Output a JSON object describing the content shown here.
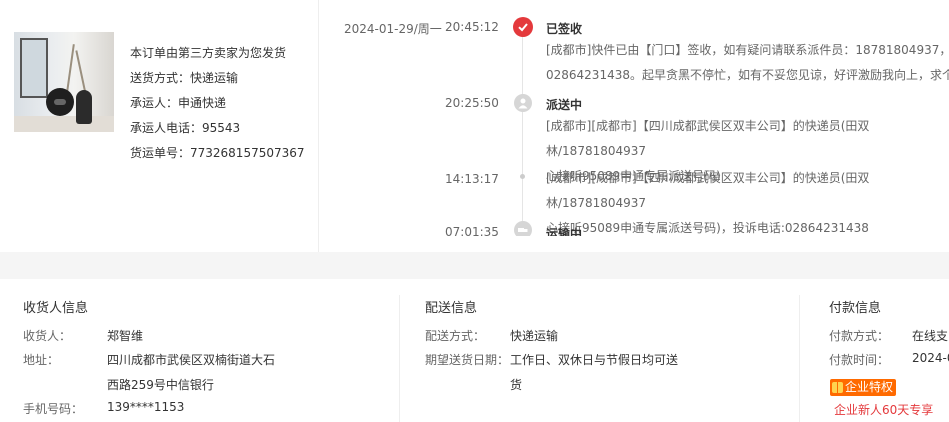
{
  "shipping": {
    "seller_note": "本订单由第三方卖家为您发货",
    "method": "送货方式：快递运输",
    "carrier": "承运人：申通快递",
    "carrier_phone": "承运人电话：95543",
    "tracking_no": "货运单号：773268157507367"
  },
  "timeline": {
    "date": "2024-01-29/周一",
    "events": [
      {
        "time": "20:45:12",
        "status": "已签收",
        "lines": [
          "[成都市]快件已由【门口】签收，如有疑问请联系派件员：18781804937，投",
          "02864231438。起早贪黑不停忙，如有不妥您见谅，好评激励我向上，求个五"
        ]
      },
      {
        "time": "20:25:50",
        "status": "派送中",
        "lines": [
          "[成都市][成都市]【四川成都武侯区双丰公司】的快递员(田双林/18781804937",
          "心接听95089申通专属派送号码)"
        ]
      },
      {
        "time": "14:13:17",
        "status": "",
        "lines": [
          "[成都市][成都市]【四川成都武侯区双丰公司】的快递员(田双林/18781804937",
          "心接听95089申通专属派送号码)，投诉电话:02864231438"
        ]
      },
      {
        "time": "07:01:35",
        "status": "运输中",
        "lines": []
      }
    ],
    "icons": {
      "signed": "check-icon",
      "delivering": "courier-icon",
      "transit": "truck-icon"
    },
    "accent": "#e4393c"
  },
  "receiver": {
    "title": "收货人信息",
    "name_label": "收货人：",
    "name": "郑智维",
    "address_label": "地址：",
    "address_line1": "四川成都市武侯区双楠街道大石",
    "address_line2": "西路259号中信银行",
    "phone_label": "手机号码：",
    "phone": "139****1153"
  },
  "delivery": {
    "title": "配送信息",
    "method_label": "配送方式：",
    "method": "快递运输",
    "date_label": "期望送货日期：",
    "date_line1": "工作日、双休日与节假日均可送",
    "date_line2": "货"
  },
  "payment": {
    "title": "付款信息",
    "method_label": "付款方式：",
    "method": "在线支",
    "time_label": "付款时间：",
    "time": "2024-0",
    "badge": "企业特权",
    "promo": "企业新人60天专享"
  }
}
